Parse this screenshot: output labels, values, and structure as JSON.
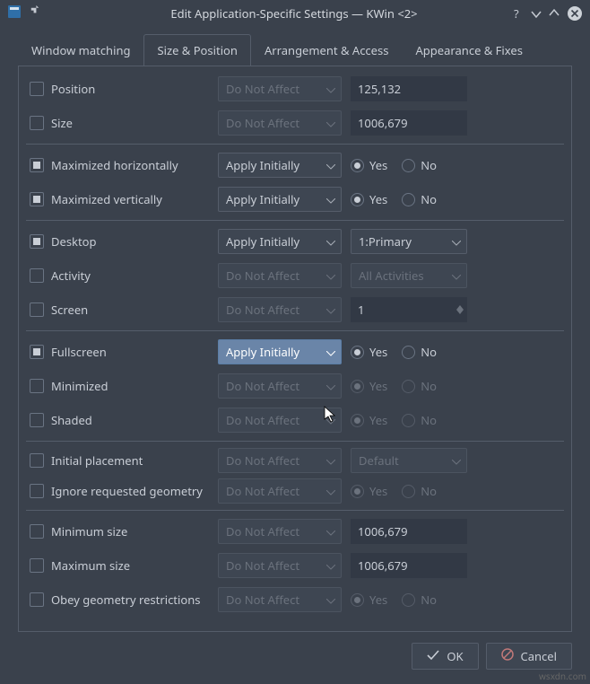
{
  "title": "Edit Application-Specific Settings — KWin <2>",
  "tabs": {
    "window_matching": "Window matching",
    "size_position": "Size & Position",
    "arrangement_access": "Arrangement & Access",
    "appearance_fixes": "Appearance & Fixes"
  },
  "rules": {
    "do_not_affect": "Do Not Affect",
    "apply_initially": "Apply Initially"
  },
  "radio": {
    "yes": "Yes",
    "no": "No"
  },
  "settings": {
    "position": {
      "label": "Position",
      "value": "125,132"
    },
    "size": {
      "label": "Size",
      "value": "1006,679"
    },
    "max_h": {
      "label": "Maximized horizontally"
    },
    "max_v": {
      "label": "Maximized vertically"
    },
    "desktop": {
      "label": "Desktop",
      "value": "1:Primary"
    },
    "activity": {
      "label": "Activity",
      "value": "All Activities"
    },
    "screen": {
      "label": "Screen",
      "value": "1"
    },
    "fullscreen": {
      "label": "Fullscreen"
    },
    "minimized": {
      "label": "Minimized"
    },
    "shaded": {
      "label": "Shaded"
    },
    "initial_placement": {
      "label": "Initial placement",
      "value": "Default"
    },
    "ignore_geo": {
      "label": "Ignore requested geometry"
    },
    "min_size": {
      "label": "Minimum size",
      "value": "1006,679"
    },
    "max_size": {
      "label": "Maximum size",
      "value": "1006,679"
    },
    "obey_geo": {
      "label": "Obey geometry restrictions"
    }
  },
  "buttons": {
    "ok": "OK",
    "cancel": "Cancel"
  },
  "watermark": "wsxdn.com"
}
